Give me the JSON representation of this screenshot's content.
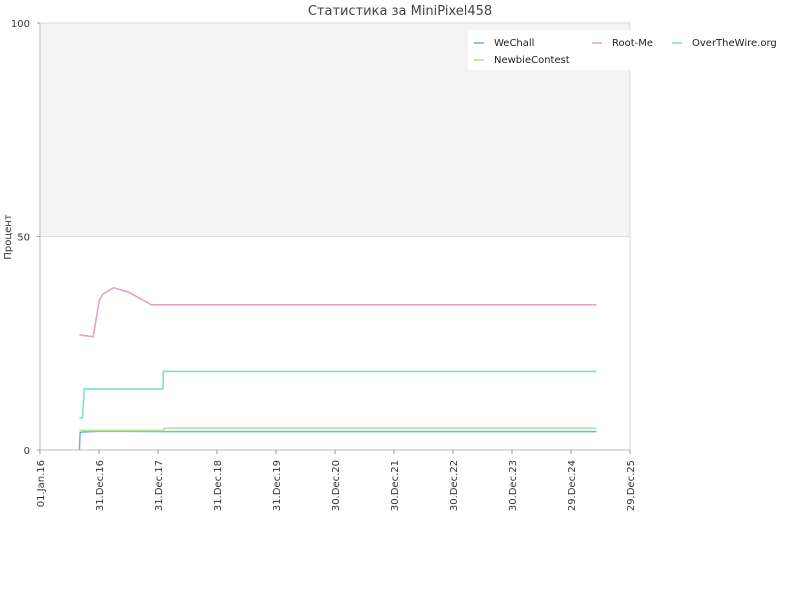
{
  "chart_data": {
    "type": "line",
    "title": "Статистика за MiniPixel458",
    "xlabel": "",
    "ylabel": "Процент",
    "xlim": [
      "2016-01-01",
      "2025-12-29"
    ],
    "ylim": [
      0,
      100
    ],
    "yticks": [
      0,
      50,
      100
    ],
    "xticks": [
      "01.Jan.16",
      "31.Dec.16",
      "31.Dec.17",
      "31.Dec.18",
      "31.Dec.19",
      "30.Dec.20",
      "30.Dec.21",
      "30.Dec.22",
      "30.Dec.23",
      "29.Dec.24",
      "29.Dec.25"
    ],
    "xtick_dates": [
      "2016-01-01",
      "2016-12-31",
      "2017-12-31",
      "2018-12-31",
      "2019-12-31",
      "2020-12-30",
      "2021-12-30",
      "2022-12-30",
      "2023-12-30",
      "2024-12-29",
      "2025-12-29"
    ],
    "legend_position": "top-right",
    "series": [
      {
        "name": "WeChall",
        "color": "#7ab0e6",
        "x": [
          "2016-09-01",
          "2016-09-05",
          "2016-09-15",
          "2017-01-15",
          "2018-02-01",
          "2025-06-05"
        ],
        "y": [
          0,
          4,
          4.2,
          4.4,
          4.3,
          4.3
        ]
      },
      {
        "name": "Root-Me",
        "color": "#e9a1c8",
        "x": [
          "2016-09-01",
          "2016-10-01",
          "2016-11-25",
          "2017-01-01",
          "2017-01-25",
          "2017-04-01",
          "2017-07-01",
          "2017-11-20",
          "2018-02-01",
          "2025-06-05"
        ],
        "y": [
          27,
          26.8,
          26.5,
          35,
          36.5,
          38,
          37,
          34,
          34,
          34
        ]
      },
      {
        "name": "OverTheWire.org",
        "color": "#7fe0cc",
        "x": [
          "2016-09-01",
          "2016-09-20",
          "2016-10-01",
          "2017-01-01",
          "2017-11-20",
          "2018-01-31",
          "2018-02-01",
          "2025-06-05"
        ],
        "y": [
          7.5,
          7.5,
          14.3,
          14.3,
          14.3,
          14.3,
          18.4,
          18.4
        ]
      },
      {
        "name": "NewbieContest",
        "color": "#aee6a0",
        "x": [
          "2016-09-01",
          "2017-06-01",
          "2018-02-01",
          "2018-02-10",
          "2025-06-05"
        ],
        "y": [
          4.6,
          4.6,
          4.6,
          5.1,
          5.1
        ]
      }
    ]
  }
}
